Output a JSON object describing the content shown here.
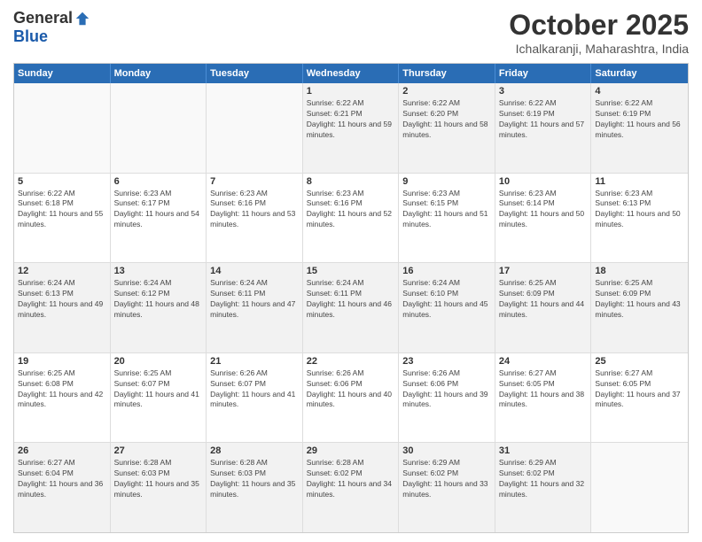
{
  "header": {
    "logo_general": "General",
    "logo_blue": "Blue",
    "month_title": "October 2025",
    "location": "Ichalkaranji, Maharashtra, India"
  },
  "calendar": {
    "days_of_week": [
      "Sunday",
      "Monday",
      "Tuesday",
      "Wednesday",
      "Thursday",
      "Friday",
      "Saturday"
    ],
    "weeks": [
      [
        {
          "day": "",
          "empty": true
        },
        {
          "day": "",
          "empty": true
        },
        {
          "day": "",
          "empty": true
        },
        {
          "day": "1",
          "sunrise": "6:22 AM",
          "sunset": "6:21 PM",
          "daylight": "11 hours and 59 minutes."
        },
        {
          "day": "2",
          "sunrise": "6:22 AM",
          "sunset": "6:20 PM",
          "daylight": "11 hours and 58 minutes."
        },
        {
          "day": "3",
          "sunrise": "6:22 AM",
          "sunset": "6:19 PM",
          "daylight": "11 hours and 57 minutes."
        },
        {
          "day": "4",
          "sunrise": "6:22 AM",
          "sunset": "6:19 PM",
          "daylight": "11 hours and 56 minutes."
        }
      ],
      [
        {
          "day": "5",
          "sunrise": "6:22 AM",
          "sunset": "6:18 PM",
          "daylight": "11 hours and 55 minutes."
        },
        {
          "day": "6",
          "sunrise": "6:23 AM",
          "sunset": "6:17 PM",
          "daylight": "11 hours and 54 minutes."
        },
        {
          "day": "7",
          "sunrise": "6:23 AM",
          "sunset": "6:16 PM",
          "daylight": "11 hours and 53 minutes."
        },
        {
          "day": "8",
          "sunrise": "6:23 AM",
          "sunset": "6:16 PM",
          "daylight": "11 hours and 52 minutes."
        },
        {
          "day": "9",
          "sunrise": "6:23 AM",
          "sunset": "6:15 PM",
          "daylight": "11 hours and 51 minutes."
        },
        {
          "day": "10",
          "sunrise": "6:23 AM",
          "sunset": "6:14 PM",
          "daylight": "11 hours and 50 minutes."
        },
        {
          "day": "11",
          "sunrise": "6:23 AM",
          "sunset": "6:13 PM",
          "daylight": "11 hours and 50 minutes."
        }
      ],
      [
        {
          "day": "12",
          "sunrise": "6:24 AM",
          "sunset": "6:13 PM",
          "daylight": "11 hours and 49 minutes."
        },
        {
          "day": "13",
          "sunrise": "6:24 AM",
          "sunset": "6:12 PM",
          "daylight": "11 hours and 48 minutes."
        },
        {
          "day": "14",
          "sunrise": "6:24 AM",
          "sunset": "6:11 PM",
          "daylight": "11 hours and 47 minutes."
        },
        {
          "day": "15",
          "sunrise": "6:24 AM",
          "sunset": "6:11 PM",
          "daylight": "11 hours and 46 minutes."
        },
        {
          "day": "16",
          "sunrise": "6:24 AM",
          "sunset": "6:10 PM",
          "daylight": "11 hours and 45 minutes."
        },
        {
          "day": "17",
          "sunrise": "6:25 AM",
          "sunset": "6:09 PM",
          "daylight": "11 hours and 44 minutes."
        },
        {
          "day": "18",
          "sunrise": "6:25 AM",
          "sunset": "6:09 PM",
          "daylight": "11 hours and 43 minutes."
        }
      ],
      [
        {
          "day": "19",
          "sunrise": "6:25 AM",
          "sunset": "6:08 PM",
          "daylight": "11 hours and 42 minutes."
        },
        {
          "day": "20",
          "sunrise": "6:25 AM",
          "sunset": "6:07 PM",
          "daylight": "11 hours and 41 minutes."
        },
        {
          "day": "21",
          "sunrise": "6:26 AM",
          "sunset": "6:07 PM",
          "daylight": "11 hours and 41 minutes."
        },
        {
          "day": "22",
          "sunrise": "6:26 AM",
          "sunset": "6:06 PM",
          "daylight": "11 hours and 40 minutes."
        },
        {
          "day": "23",
          "sunrise": "6:26 AM",
          "sunset": "6:06 PM",
          "daylight": "11 hours and 39 minutes."
        },
        {
          "day": "24",
          "sunrise": "6:27 AM",
          "sunset": "6:05 PM",
          "daylight": "11 hours and 38 minutes."
        },
        {
          "day": "25",
          "sunrise": "6:27 AM",
          "sunset": "6:05 PM",
          "daylight": "11 hours and 37 minutes."
        }
      ],
      [
        {
          "day": "26",
          "sunrise": "6:27 AM",
          "sunset": "6:04 PM",
          "daylight": "11 hours and 36 minutes."
        },
        {
          "day": "27",
          "sunrise": "6:28 AM",
          "sunset": "6:03 PM",
          "daylight": "11 hours and 35 minutes."
        },
        {
          "day": "28",
          "sunrise": "6:28 AM",
          "sunset": "6:03 PM",
          "daylight": "11 hours and 35 minutes."
        },
        {
          "day": "29",
          "sunrise": "6:28 AM",
          "sunset": "6:02 PM",
          "daylight": "11 hours and 34 minutes."
        },
        {
          "day": "30",
          "sunrise": "6:29 AM",
          "sunset": "6:02 PM",
          "daylight": "11 hours and 33 minutes."
        },
        {
          "day": "31",
          "sunrise": "6:29 AM",
          "sunset": "6:02 PM",
          "daylight": "11 hours and 32 minutes."
        },
        {
          "day": "",
          "empty": true
        }
      ]
    ]
  }
}
